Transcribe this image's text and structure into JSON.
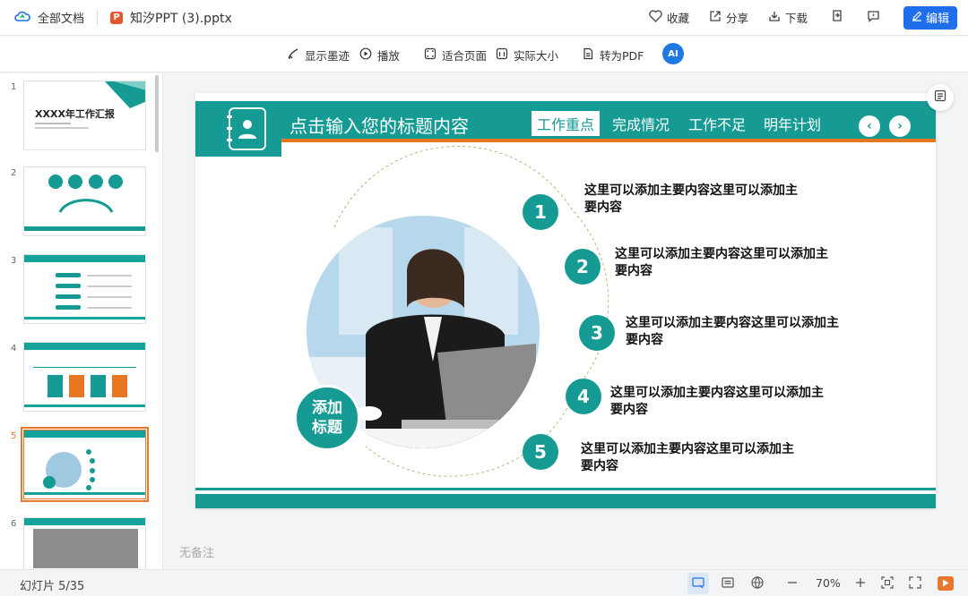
{
  "topbar": {
    "all_docs": "全部文档",
    "file_badge": "P",
    "filename": "知汐PPT (3).pptx",
    "favorite": "收藏",
    "share": "分享",
    "download": "下载",
    "edit": "编辑"
  },
  "toolbar": {
    "show_ink": "显示墨迹",
    "play": "播放",
    "fit_page": "适合页面",
    "actual_size": "实际大小",
    "to_pdf": "转为PDF",
    "ai_label": "AI"
  },
  "thumbnails": [
    {
      "num": "1",
      "title": "XXXX年工作汇报"
    },
    {
      "num": "2"
    },
    {
      "num": "3"
    },
    {
      "num": "4"
    },
    {
      "num": "5",
      "active": true
    },
    {
      "num": "6"
    }
  ],
  "slide": {
    "header_title": "点击输入您的标题内容",
    "tabs": [
      "工作重点",
      "完成情况",
      "工作不足",
      "明年计划"
    ],
    "active_tab": "工作重点",
    "add_title": "添加\n标题",
    "items": [
      {
        "num": "1",
        "text": "这里可以添加主要内容这里可以添加主要内容"
      },
      {
        "num": "2",
        "text": "这里可以添加主要内容这里可以添加主要内容"
      },
      {
        "num": "3",
        "text": "这里可以添加主要内容这里可以添加主要内容"
      },
      {
        "num": "4",
        "text": "这里可以添加主要内容这里可以添加主要内容"
      },
      {
        "num": "5",
        "text": "这里可以添加主要内容这里可以添加主要内容"
      }
    ],
    "accent_color": "#169b94",
    "orange_color": "#e87722"
  },
  "notes": "无备注",
  "status": {
    "slide_count": "幻灯片 5/35",
    "zoom": "70%"
  }
}
